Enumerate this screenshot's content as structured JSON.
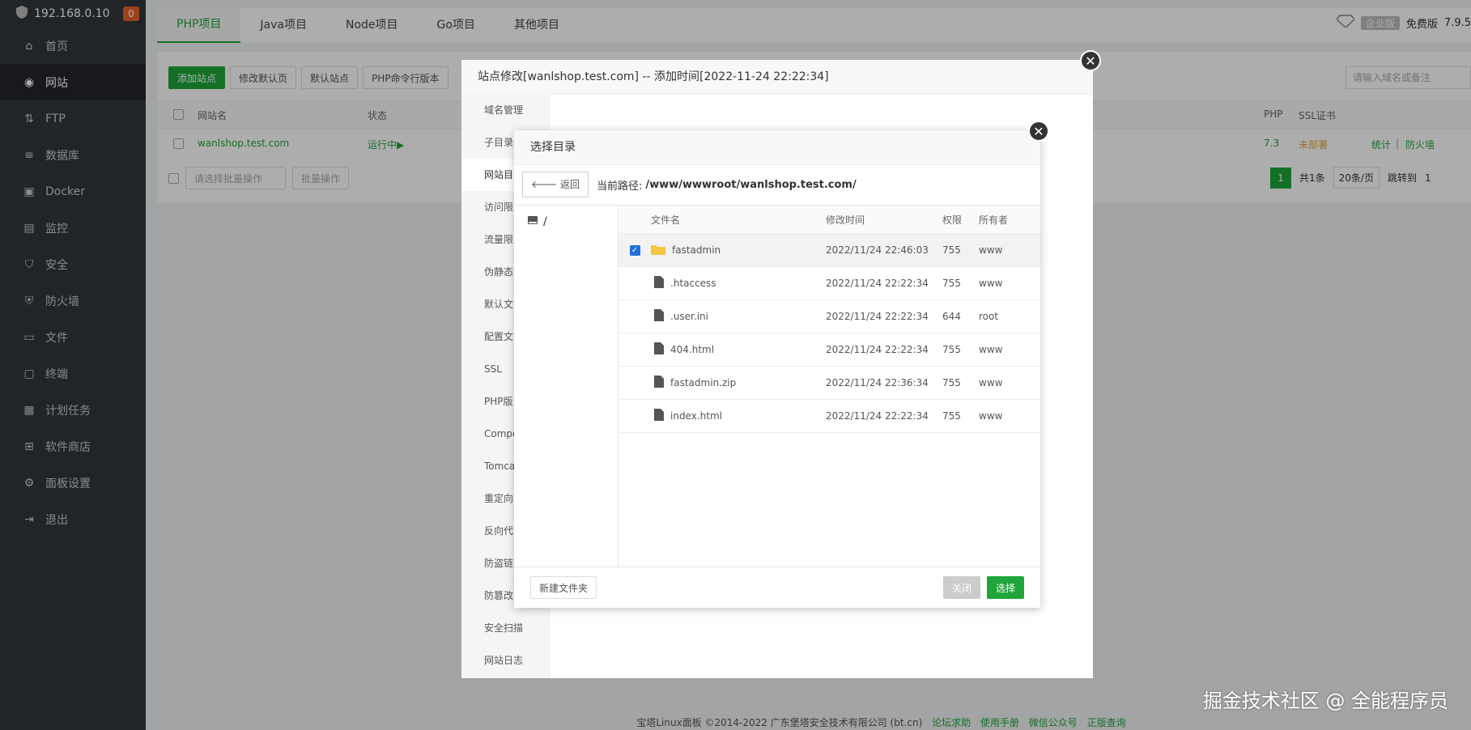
{
  "sidebar": {
    "ip": "192.168.0.10",
    "badge": "0",
    "items": [
      {
        "label": "首页",
        "icon": "home-icon"
      },
      {
        "label": "网站",
        "icon": "globe-icon"
      },
      {
        "label": "FTP",
        "icon": "ftp-icon"
      },
      {
        "label": "数据库",
        "icon": "database-icon"
      },
      {
        "label": "Docker",
        "icon": "docker-icon"
      },
      {
        "label": "监控",
        "icon": "monitor-icon"
      },
      {
        "label": "安全",
        "icon": "shield-icon"
      },
      {
        "label": "防火墙",
        "icon": "firewall-icon"
      },
      {
        "label": "文件",
        "icon": "folder-icon"
      },
      {
        "label": "终端",
        "icon": "terminal-icon"
      },
      {
        "label": "计划任务",
        "icon": "calendar-icon"
      },
      {
        "label": "软件商店",
        "icon": "apps-icon"
      },
      {
        "label": "面板设置",
        "icon": "gear-icon"
      },
      {
        "label": "退出",
        "icon": "logout-icon"
      }
    ]
  },
  "tabs": [
    "PHP项目",
    "Java项目",
    "Node项目",
    "Go项目",
    "其他项目"
  ],
  "top_right": {
    "enterprise": "企业版",
    "free": "免费版",
    "version": "7.9.5"
  },
  "toolbar": {
    "add_site": "添加站点",
    "edit_default": "修改默认页",
    "default_site": "默认站点",
    "php_cli": "PHP命令行版本",
    "search_placeholder": "请输入域名或备注"
  },
  "site_table": {
    "headers": {
      "name": "网站名",
      "status": "状态",
      "php": "PHP",
      "ssl": "SSL证书"
    },
    "row": {
      "name": "wanlshop.test.com",
      "status": "运行中▶",
      "php": "7.3",
      "ssl": "未部署",
      "stats": "统计",
      "firewall": "防火墙",
      "sep": "|"
    },
    "batch_placeholder": "请选择批量操作",
    "batch_btn": "批量操作",
    "pagination": {
      "page": "1",
      "total": "共1条",
      "per_page": "20条/页",
      "jump": "跳转到",
      "jump_val": "1"
    }
  },
  "outer_dialog": {
    "title": "站点修改[wanlshop.test.com] -- 添加时间[2022-11-24 22:22:34]",
    "nav": [
      "域名管理",
      "子目录",
      "网站目",
      "访问限",
      "流量限",
      "伪静态",
      "默认文",
      "配置文",
      "SSL",
      "PHP版",
      "Compo",
      "Tomca",
      "重定向",
      "反向代",
      "防盗链",
      "防篡改",
      "安全扫描",
      "网站日志"
    ]
  },
  "dialog": {
    "title": "选择目录",
    "back": "返回",
    "path_label": "当前路径:",
    "path": "/www/wwwroot/wanlshop.test.com/",
    "tree_root": "/",
    "headers": {
      "name": "文件名",
      "time": "修改时间",
      "perm": "权限",
      "owner": "所有者"
    },
    "files": [
      {
        "name": "fastadmin",
        "time": "2022/11/24 22:46:03",
        "perm": "755",
        "owner": "www",
        "type": "folder",
        "checked": true
      },
      {
        "name": ".htaccess",
        "time": "2022/11/24 22:22:34",
        "perm": "755",
        "owner": "www",
        "type": "file"
      },
      {
        "name": ".user.ini",
        "time": "2022/11/24 22:22:34",
        "perm": "644",
        "owner": "root",
        "type": "file"
      },
      {
        "name": "404.html",
        "time": "2022/11/24 22:22:34",
        "perm": "755",
        "owner": "www",
        "type": "file"
      },
      {
        "name": "fastadmin.zip",
        "time": "2022/11/24 22:36:34",
        "perm": "755",
        "owner": "www",
        "type": "file"
      },
      {
        "name": "index.html",
        "time": "2022/11/24 22:22:34",
        "perm": "755",
        "owner": "www",
        "type": "file"
      }
    ],
    "new_folder": "新建文件夹",
    "close": "关闭",
    "select": "选择"
  },
  "footer": {
    "copyright": "宝塔Linux面板 ©2014-2022 广东堡塔安全技术有限公司 (bt.cn)",
    "links": [
      "论坛求助",
      "使用手册",
      "微信公众号",
      "正版查询"
    ]
  },
  "watermark": "掘金技术社区 @ 全能程序员",
  "colors": {
    "green": "#20a53a",
    "sidebar": "#32373c",
    "orange": "#e8612c"
  }
}
